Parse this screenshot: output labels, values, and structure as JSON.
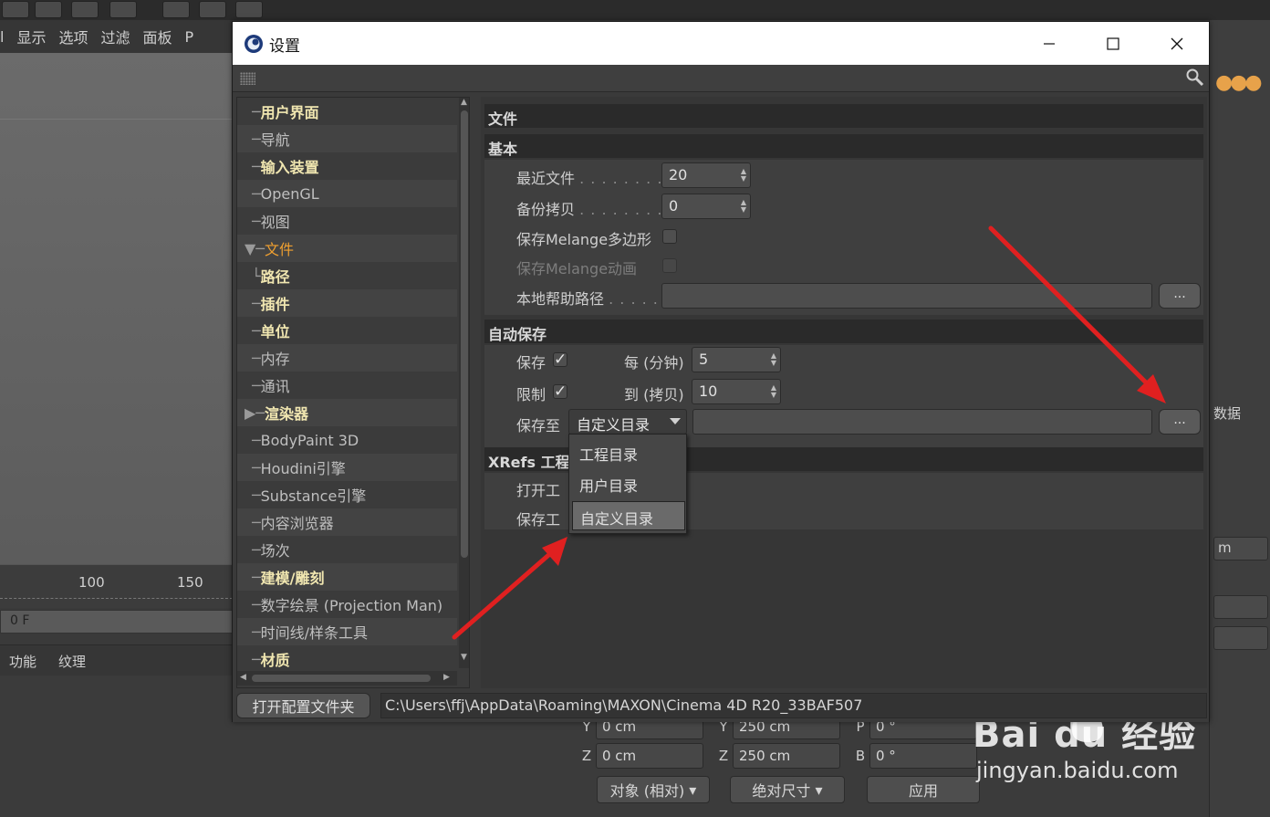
{
  "background": {
    "menu_items": [
      "l",
      "显示",
      "选项",
      "过滤",
      "面板",
      "P"
    ],
    "ruler_ticks": [
      "100",
      "150"
    ],
    "frame_value": "0 F",
    "material_menu": [
      "功能",
      "纹理"
    ],
    "coords": {
      "row_y": {
        "axis1": "Y",
        "val1": "0 cm",
        "axis2": "Y",
        "val2": "250 cm",
        "axis3": "P",
        "val3": "0 °"
      },
      "row_z": {
        "axis1": "Z",
        "val1": "0 cm",
        "axis2": "Z",
        "val2": "250 cm",
        "axis3": "B",
        "val3": "0 °"
      }
    },
    "object_mode": "对象 (相对)",
    "size_mode": "绝对尺寸",
    "apply_label": "应用",
    "right_panel": {
      "tab_label": "数据",
      "unit_label": "m"
    }
  },
  "watermark": {
    "brand": "Bai du 经验",
    "url": "jingyan.baidu.com"
  },
  "dialog": {
    "title": "设置",
    "tree": [
      {
        "label": "用户界面",
        "bold": true,
        "conn": "─"
      },
      {
        "label": "导航",
        "bold": false,
        "conn": "─"
      },
      {
        "label": "输入装置",
        "bold": true,
        "conn": "─"
      },
      {
        "label": "OpenGL",
        "bold": false,
        "conn": "─"
      },
      {
        "label": "视图",
        "bold": false,
        "conn": "─"
      },
      {
        "label": "文件",
        "bold": false,
        "active": true,
        "conn": "▼─"
      },
      {
        "label": "路径",
        "bold": true,
        "conn": "   └"
      },
      {
        "label": "插件",
        "bold": true,
        "conn": "─"
      },
      {
        "label": "单位",
        "bold": true,
        "conn": "─"
      },
      {
        "label": "内存",
        "bold": false,
        "conn": "─"
      },
      {
        "label": "通讯",
        "bold": false,
        "conn": "─"
      },
      {
        "label": "渲染器",
        "bold": true,
        "conn": "▶─"
      },
      {
        "label": "BodyPaint 3D",
        "bold": false,
        "conn": "─"
      },
      {
        "label": "Houdini引擎",
        "bold": false,
        "conn": "─"
      },
      {
        "label": "Substance引擎",
        "bold": false,
        "conn": "─"
      },
      {
        "label": "内容浏览器",
        "bold": false,
        "conn": "─"
      },
      {
        "label": "场次",
        "bold": false,
        "conn": "─"
      },
      {
        "label": "建模/雕刻",
        "bold": true,
        "conn": "─"
      },
      {
        "label": "数字绘景 (Projection Man)",
        "bold": false,
        "conn": "─"
      },
      {
        "label": "时间线/样条工具",
        "bold": false,
        "conn": "─"
      },
      {
        "label": "材质",
        "bold": true,
        "conn": "─"
      }
    ],
    "content": {
      "header": "文件",
      "basic": {
        "title": "基本",
        "recent_files_label": "最近文件",
        "recent_files_value": "20",
        "backup_label": "备份拷贝",
        "backup_value": "0",
        "save_melange_poly_label": "保存Melange多边形",
        "save_melange_anim_label": "保存Melange动画",
        "local_help_label": "本地帮助路径",
        "dots": ". . . . . . . . .",
        "browse_label": "..."
      },
      "autosave": {
        "title": "自动保存",
        "save_label": "保存",
        "every_label": "每 (分钟)",
        "every_value": "5",
        "limit_label": "限制",
        "to_label": "到 (拷贝)",
        "to_value": "10",
        "save_to_label": "保存至",
        "save_to_selected": "自定义目录",
        "check_mark": "✓"
      },
      "xrefs": {
        "title": "XRefs 工程",
        "open_label": "打开工",
        "save_label": "保存工"
      },
      "dropdown_options": [
        "工程目录",
        "用户目录",
        "自定义目录"
      ]
    },
    "footer": {
      "open_folder_label": "打开配置文件夹",
      "path": "C:\\Users\\ffj\\AppData\\Roaming\\MAXON\\Cinema 4D R20_33BAF507"
    }
  }
}
